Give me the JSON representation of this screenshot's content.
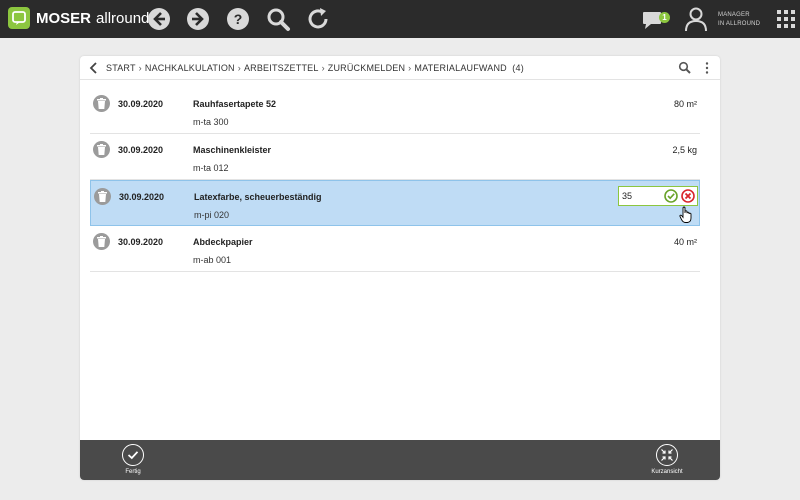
{
  "app": {
    "brand_bold": "MOSER",
    "brand_light": "allround",
    "chat_badge_count": "1",
    "user_line1": "MANAGER",
    "user_line2": "IN ALLROUND"
  },
  "toolbar_icons": [
    "back-icon",
    "forward-icon",
    "help-icon",
    "search-icon",
    "refresh-icon",
    "chat-icon",
    "user-icon",
    "apps-grid-icon"
  ],
  "breadcrumb": {
    "items": [
      "START",
      "NACHKALKULATION",
      "ARBEITSZETTEL",
      "ZURÜCKMELDEN",
      "MATERIALAUFWAND"
    ],
    "separator": "›",
    "count": "(4)"
  },
  "rows": [
    {
      "date": "30.09.2020",
      "name": "Rauhfasertapete 52",
      "code": "m-ta 300",
      "qty": "80 m²"
    },
    {
      "date": "30.09.2020",
      "name": "Maschinenkleister",
      "code": "m-ta 012",
      "qty": "2,5 kg"
    },
    {
      "date": "30.09.2020",
      "name": "Latexfarbe, scheuerbeständig",
      "code": "m-pi 020",
      "qty_input": "35"
    },
    {
      "date": "30.09.2020",
      "name": "Abdeckpapier",
      "code": "m-ab 001",
      "qty": "40 m²"
    }
  ],
  "colors": {
    "topbar": "#2b2b2b",
    "accent_green": "#8cc63f",
    "selected_row": "#bfdcf5",
    "cancel_red": "#d9262c",
    "bottombar": "#4a4a4a"
  },
  "bottom": {
    "done_label": "Fertig",
    "compact_label": "Kurzansicht"
  }
}
